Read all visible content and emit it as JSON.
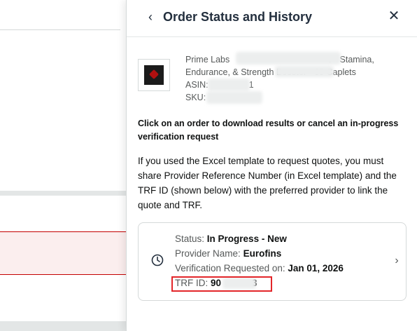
{
  "panel": {
    "title": "Order Status and History",
    "back_icon": "chevron-left-icon",
    "close_icon": "close-icon"
  },
  "product": {
    "title_line1": "Prime Labs",
    "title_line1_end": "r - Stamina,",
    "title_line2": "Endurance, & Strength Booster - 60 Caplets",
    "asin_label": "ASIN:",
    "asin_tail": "1",
    "sku_label": "SKU:"
  },
  "instructions": {
    "bold": "Click on an order to download results or cancel an in-progress verification request",
    "body": "If you used the Excel template to request quotes, you must share Provider Reference Number (in Excel template) and the TRF ID (shown below) with the preferred provider to link the quote and TRF."
  },
  "order": {
    "status_label": "Status:",
    "status_value": "In Progress - New",
    "provider_label": "Provider Name:",
    "provider_value": "Eurofins",
    "requested_label": "Verification Requested on:",
    "requested_value": "Jan 01, 2026",
    "trf_label": "TRF ID:",
    "trf_prefix": "90",
    "trf_suffix": "3",
    "icon": "clock-icon",
    "chevron": "chevron-right-icon"
  },
  "colors": {
    "accent_dark": "#232f3e",
    "highlight_red": "#e3262a",
    "secondary_text": "#565959",
    "border": "#d5d9d9"
  }
}
